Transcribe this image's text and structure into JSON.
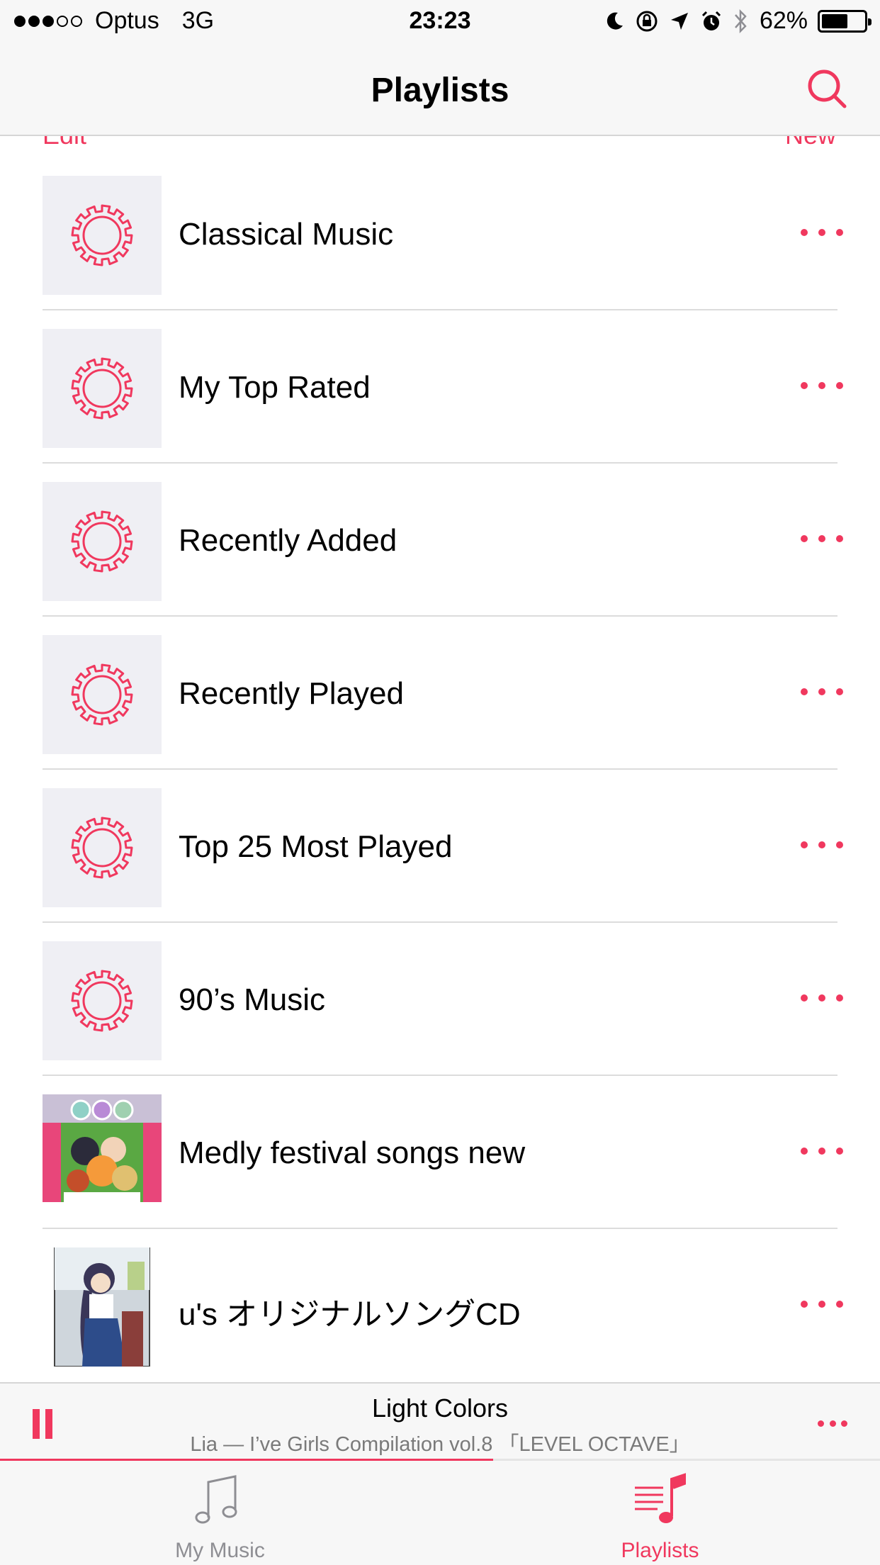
{
  "status_bar": {
    "carrier": "Optus",
    "network": "3G",
    "time": "23:23",
    "battery_percent": "62%",
    "battery_level": 0.62
  },
  "nav": {
    "title": "Playlists",
    "edit_label": "Edit",
    "new_label": "New"
  },
  "playlists": [
    {
      "title": "Classical Music",
      "art": "gear-icon"
    },
    {
      "title": "My Top Rated",
      "art": "gear-icon"
    },
    {
      "title": "Recently Added",
      "art": "gear-icon"
    },
    {
      "title": "Recently Played",
      "art": "gear-icon"
    },
    {
      "title": "Top 25 Most Played",
      "art": "gear-icon"
    },
    {
      "title": "90’s Music",
      "art": "gear-icon"
    },
    {
      "title": "Medly festival songs new",
      "art": "album-cover"
    },
    {
      "title": "u's オリジナルソングCD",
      "art": "album-cover"
    }
  ],
  "now_playing": {
    "title": "Light Colors",
    "subtitle": "Lia — I’ve Girls Compilation vol.8 「LEVEL OCTAVE」",
    "progress": 0.56
  },
  "tabs": [
    {
      "label": "My Music",
      "icon": "music-note-icon",
      "active": false
    },
    {
      "label": "Playlists",
      "icon": "playlists-icon",
      "active": true
    }
  ],
  "colors": {
    "accent": "#f0385e",
    "inactive": "#8e8e93"
  }
}
